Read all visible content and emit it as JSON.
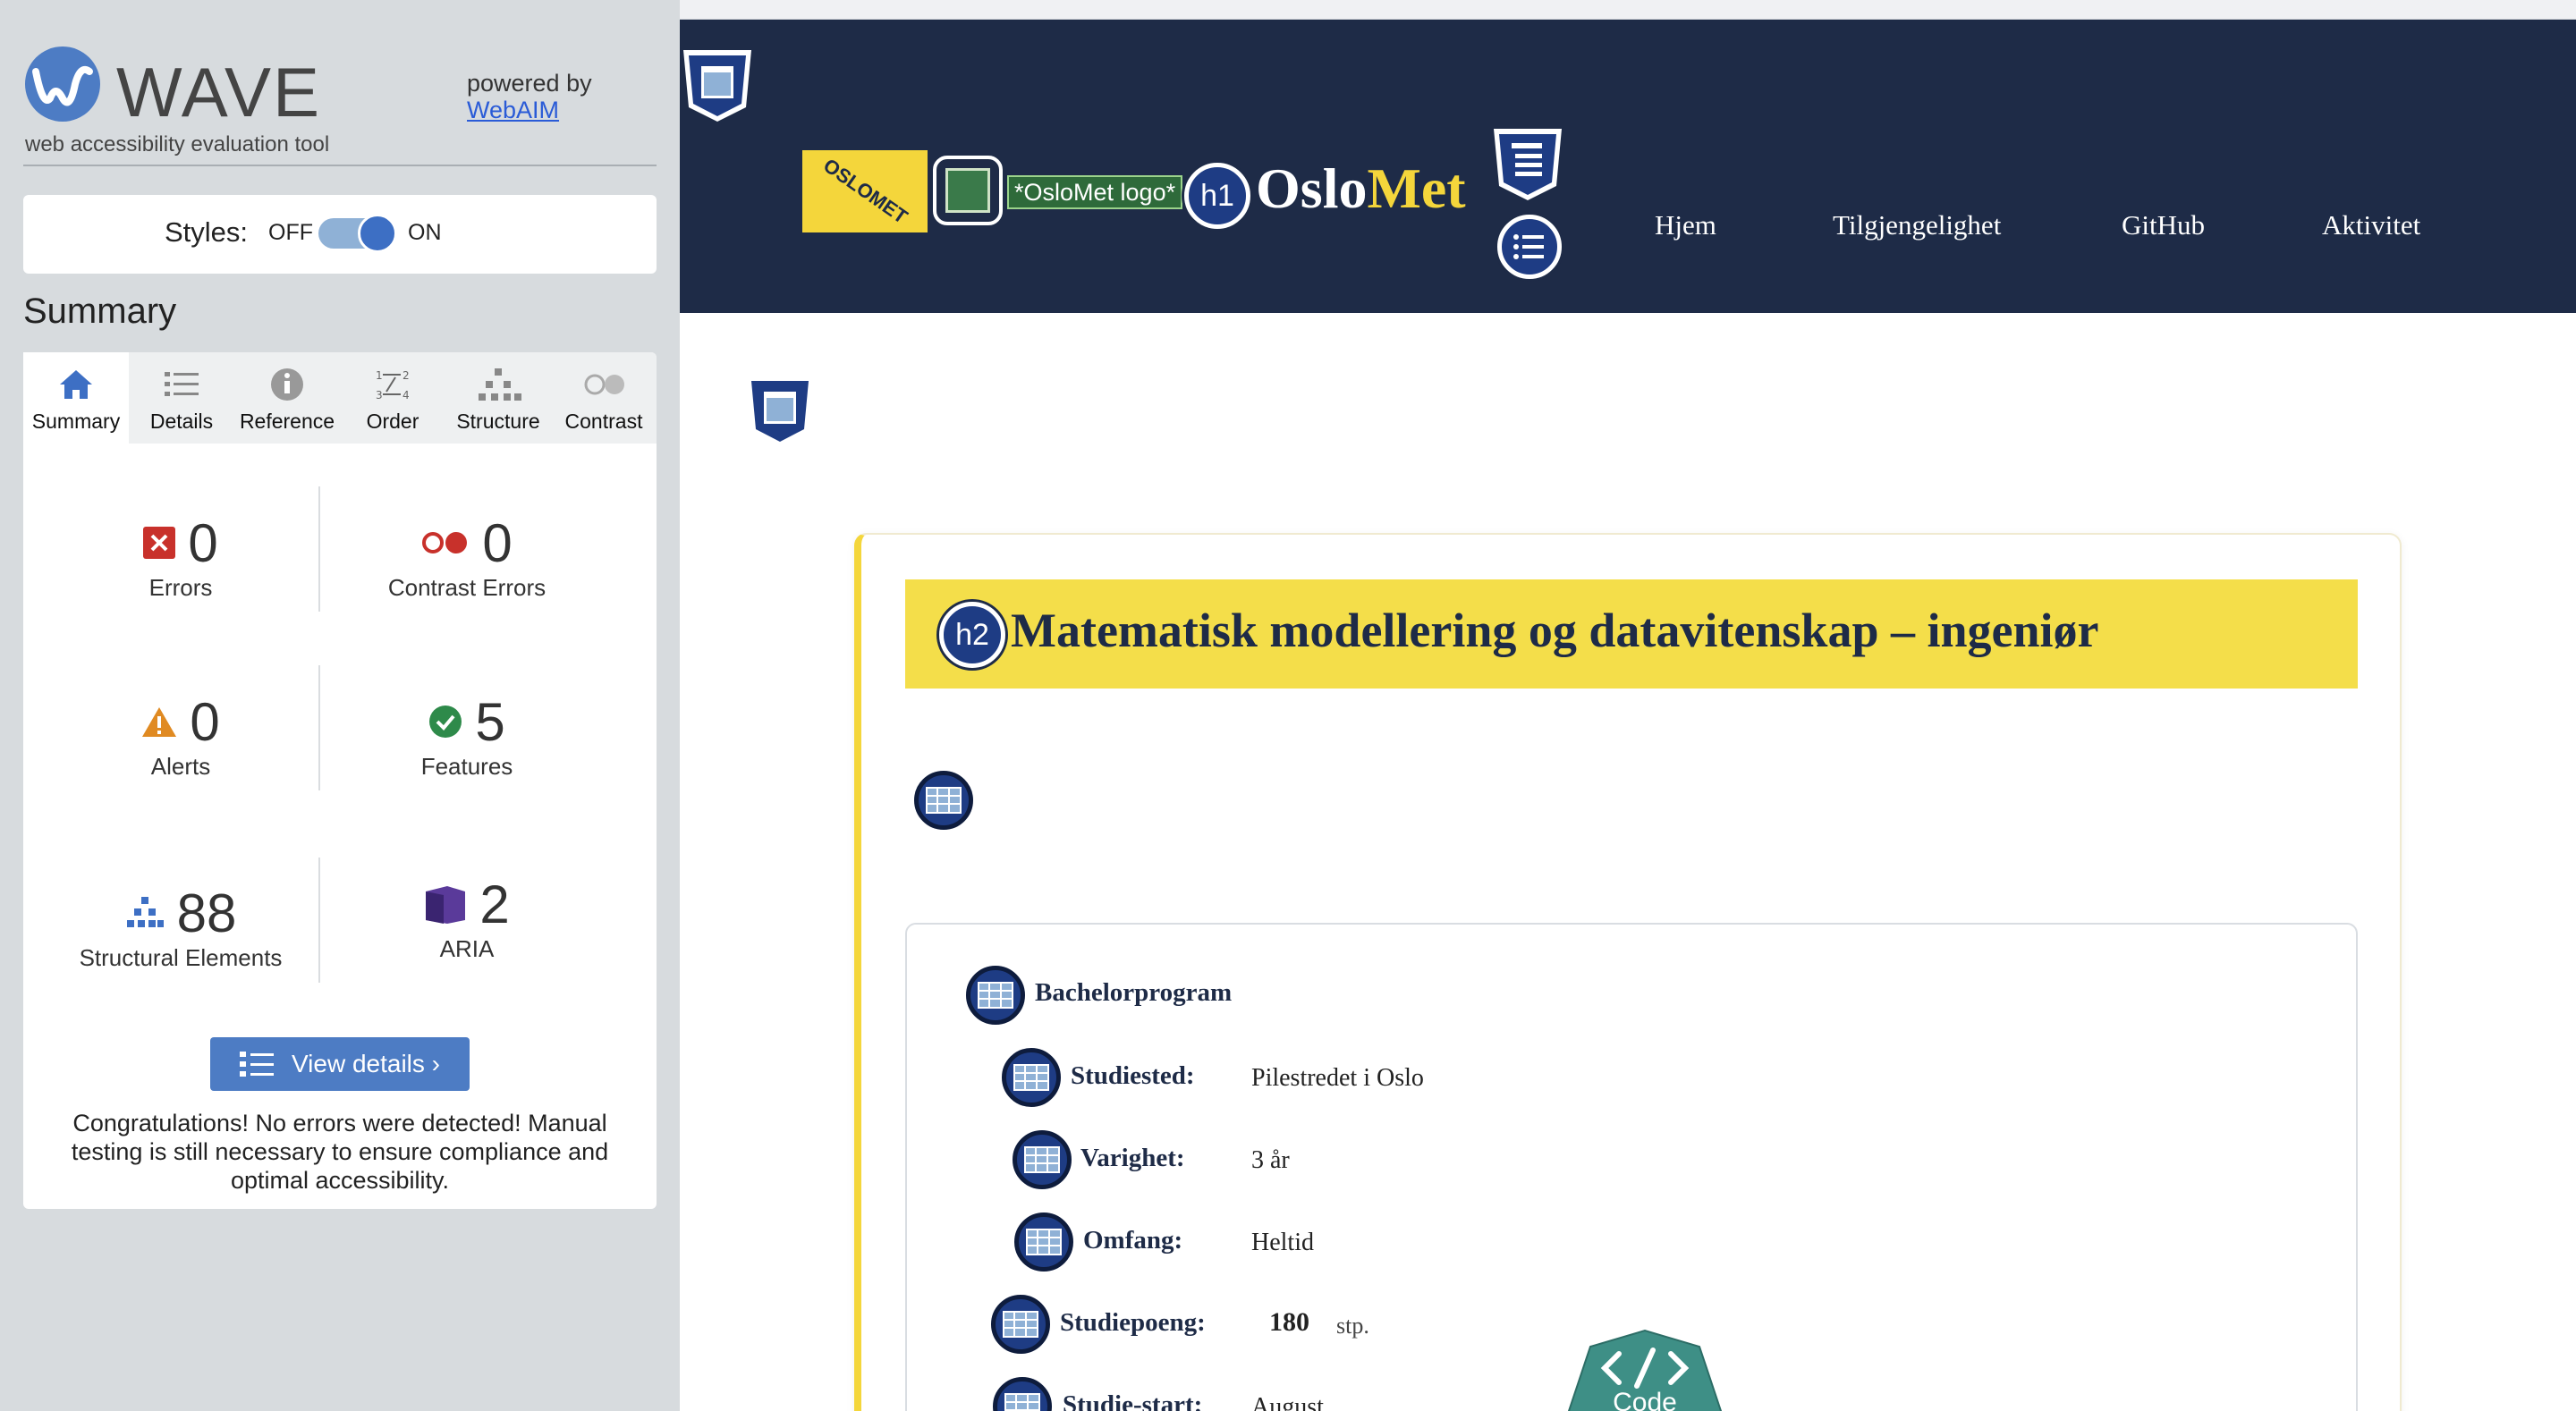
{
  "wave": {
    "title": "WAVE",
    "subtitle": "web accessibility evaluation tool",
    "powered_by": "powered by",
    "powered_link": "WebAIM",
    "styles_label": "Styles:",
    "styles_off": "OFF",
    "styles_on": "ON",
    "summary_heading": "Summary",
    "tabs": [
      {
        "label": "Summary",
        "icon": "home-icon"
      },
      {
        "label": "Details",
        "icon": "list-icon"
      },
      {
        "label": "Reference",
        "icon": "info-icon"
      },
      {
        "label": "Order",
        "icon": "order-icon"
      },
      {
        "label": "Structure",
        "icon": "structure-icon"
      },
      {
        "label": "Contrast",
        "icon": "contrast-icon"
      }
    ],
    "active_tab": "Summary",
    "stats": {
      "errors": {
        "value": "0",
        "label": "Errors"
      },
      "contrast_errors": {
        "value": "0",
        "label": "Contrast Errors"
      },
      "alerts": {
        "value": "0",
        "label": "Alerts"
      },
      "features": {
        "value": "5",
        "label": "Features"
      },
      "structural": {
        "value": "88",
        "label": "Structural Elements"
      },
      "aria": {
        "value": "2",
        "label": "ARIA"
      }
    },
    "view_details": "View details ›",
    "congrats": "Congratulations! No errors were detected! Manual testing is still necessary to ensure compliance and optimal accessibility."
  },
  "site": {
    "logo_tag": "OSLOMET",
    "alt_text": "*OsloMet logo*",
    "h1_badge": "h1",
    "brand_oslo": "Oslo",
    "brand_met": "Met",
    "nav": [
      "Hjem",
      "Tilgjengelighet",
      "GitHub",
      "Aktivitet"
    ],
    "h2_badge": "h2",
    "program_title": "Matematisk modellering og datavitenskap – ingeniør",
    "program_type": "Bachelorprogram",
    "details": [
      {
        "key": "Studiested:",
        "value": "Pilestredet i Oslo"
      },
      {
        "key": "Varighet:",
        "value": "3 år"
      },
      {
        "key": "Omfang:",
        "value": "Heltid"
      },
      {
        "key": "Studiepoeng:",
        "value": "180",
        "unit": "stp."
      },
      {
        "key": "Studie-start:",
        "value": "August"
      }
    ],
    "code_label": "Code"
  },
  "colors": {
    "header_bg": "#1e2b47",
    "accent_yellow": "#f4d63b",
    "wave_blue": "#4d7cc4",
    "sidebar_bg": "#d7dbde"
  }
}
